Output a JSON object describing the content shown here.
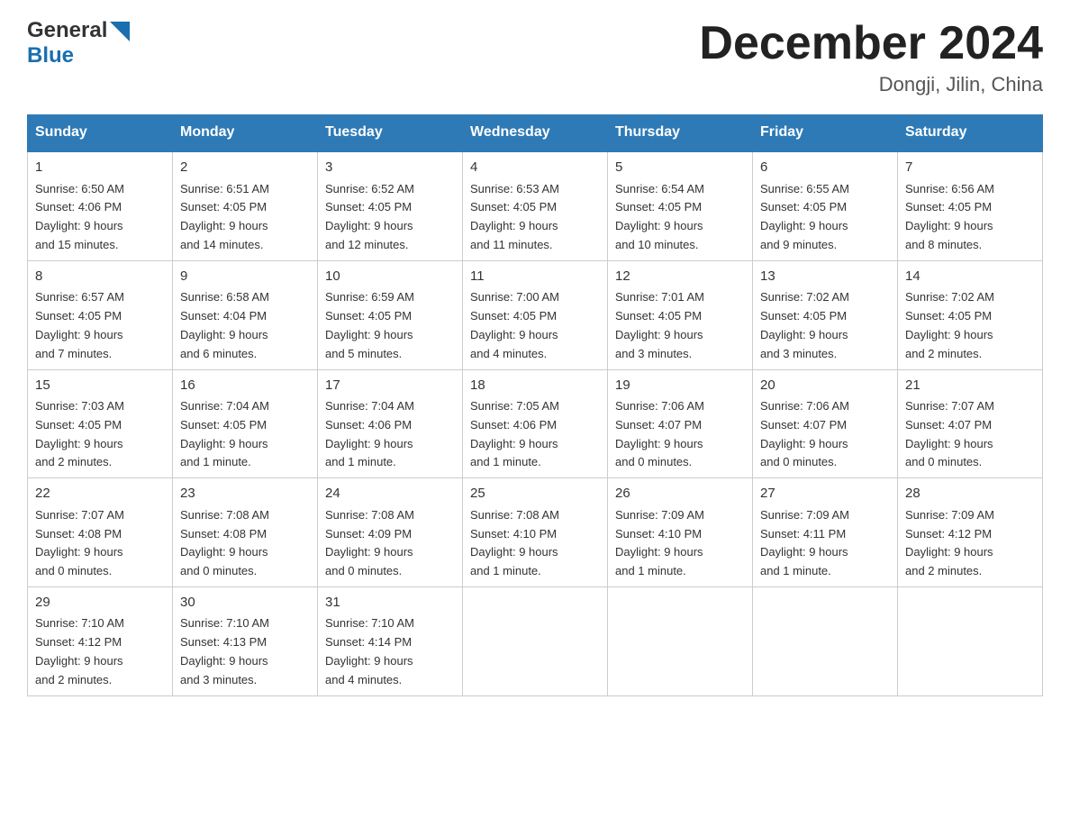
{
  "header": {
    "logo_general": "General",
    "logo_blue": "Blue",
    "title": "December 2024",
    "subtitle": "Dongji, Jilin, China"
  },
  "days_of_week": [
    "Sunday",
    "Monday",
    "Tuesday",
    "Wednesday",
    "Thursday",
    "Friday",
    "Saturday"
  ],
  "weeks": [
    [
      {
        "day": "1",
        "sunrise": "6:50 AM",
        "sunset": "4:06 PM",
        "daylight": "9 hours and 15 minutes."
      },
      {
        "day": "2",
        "sunrise": "6:51 AM",
        "sunset": "4:05 PM",
        "daylight": "9 hours and 14 minutes."
      },
      {
        "day": "3",
        "sunrise": "6:52 AM",
        "sunset": "4:05 PM",
        "daylight": "9 hours and 12 minutes."
      },
      {
        "day": "4",
        "sunrise": "6:53 AM",
        "sunset": "4:05 PM",
        "daylight": "9 hours and 11 minutes."
      },
      {
        "day": "5",
        "sunrise": "6:54 AM",
        "sunset": "4:05 PM",
        "daylight": "9 hours and 10 minutes."
      },
      {
        "day": "6",
        "sunrise": "6:55 AM",
        "sunset": "4:05 PM",
        "daylight": "9 hours and 9 minutes."
      },
      {
        "day": "7",
        "sunrise": "6:56 AM",
        "sunset": "4:05 PM",
        "daylight": "9 hours and 8 minutes."
      }
    ],
    [
      {
        "day": "8",
        "sunrise": "6:57 AM",
        "sunset": "4:05 PM",
        "daylight": "9 hours and 7 minutes."
      },
      {
        "day": "9",
        "sunrise": "6:58 AM",
        "sunset": "4:04 PM",
        "daylight": "9 hours and 6 minutes."
      },
      {
        "day": "10",
        "sunrise": "6:59 AM",
        "sunset": "4:05 PM",
        "daylight": "9 hours and 5 minutes."
      },
      {
        "day": "11",
        "sunrise": "7:00 AM",
        "sunset": "4:05 PM",
        "daylight": "9 hours and 4 minutes."
      },
      {
        "day": "12",
        "sunrise": "7:01 AM",
        "sunset": "4:05 PM",
        "daylight": "9 hours and 3 minutes."
      },
      {
        "day": "13",
        "sunrise": "7:02 AM",
        "sunset": "4:05 PM",
        "daylight": "9 hours and 3 minutes."
      },
      {
        "day": "14",
        "sunrise": "7:02 AM",
        "sunset": "4:05 PM",
        "daylight": "9 hours and 2 minutes."
      }
    ],
    [
      {
        "day": "15",
        "sunrise": "7:03 AM",
        "sunset": "4:05 PM",
        "daylight": "9 hours and 2 minutes."
      },
      {
        "day": "16",
        "sunrise": "7:04 AM",
        "sunset": "4:05 PM",
        "daylight": "9 hours and 1 minute."
      },
      {
        "day": "17",
        "sunrise": "7:04 AM",
        "sunset": "4:06 PM",
        "daylight": "9 hours and 1 minute."
      },
      {
        "day": "18",
        "sunrise": "7:05 AM",
        "sunset": "4:06 PM",
        "daylight": "9 hours and 1 minute."
      },
      {
        "day": "19",
        "sunrise": "7:06 AM",
        "sunset": "4:07 PM",
        "daylight": "9 hours and 0 minutes."
      },
      {
        "day": "20",
        "sunrise": "7:06 AM",
        "sunset": "4:07 PM",
        "daylight": "9 hours and 0 minutes."
      },
      {
        "day": "21",
        "sunrise": "7:07 AM",
        "sunset": "4:07 PM",
        "daylight": "9 hours and 0 minutes."
      }
    ],
    [
      {
        "day": "22",
        "sunrise": "7:07 AM",
        "sunset": "4:08 PM",
        "daylight": "9 hours and 0 minutes."
      },
      {
        "day": "23",
        "sunrise": "7:08 AM",
        "sunset": "4:08 PM",
        "daylight": "9 hours and 0 minutes."
      },
      {
        "day": "24",
        "sunrise": "7:08 AM",
        "sunset": "4:09 PM",
        "daylight": "9 hours and 0 minutes."
      },
      {
        "day": "25",
        "sunrise": "7:08 AM",
        "sunset": "4:10 PM",
        "daylight": "9 hours and 1 minute."
      },
      {
        "day": "26",
        "sunrise": "7:09 AM",
        "sunset": "4:10 PM",
        "daylight": "9 hours and 1 minute."
      },
      {
        "day": "27",
        "sunrise": "7:09 AM",
        "sunset": "4:11 PM",
        "daylight": "9 hours and 1 minute."
      },
      {
        "day": "28",
        "sunrise": "7:09 AM",
        "sunset": "4:12 PM",
        "daylight": "9 hours and 2 minutes."
      }
    ],
    [
      {
        "day": "29",
        "sunrise": "7:10 AM",
        "sunset": "4:12 PM",
        "daylight": "9 hours and 2 minutes."
      },
      {
        "day": "30",
        "sunrise": "7:10 AM",
        "sunset": "4:13 PM",
        "daylight": "9 hours and 3 minutes."
      },
      {
        "day": "31",
        "sunrise": "7:10 AM",
        "sunset": "4:14 PM",
        "daylight": "9 hours and 4 minutes."
      },
      null,
      null,
      null,
      null
    ]
  ],
  "labels": {
    "sunrise": "Sunrise:",
    "sunset": "Sunset:",
    "daylight": "Daylight:"
  }
}
